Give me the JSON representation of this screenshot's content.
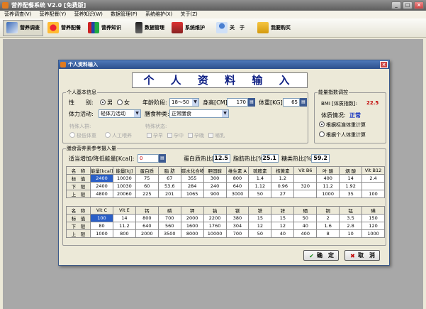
{
  "app": {
    "title": "营养配餐系统 V2.0 [免费版]"
  },
  "menubar": [
    "营养调查(V)",
    "营养配餐(Y)",
    "营养知识(W)",
    "数据管理(P)",
    "系统维护(X)",
    "关于(Z)"
  ],
  "toolbar": [
    "营养调查",
    "营养配餐",
    "营养知识",
    "数据管理",
    "系统维护",
    "关　于",
    "我要购买"
  ],
  "colors": {
    "title_blue": "#0e1f83",
    "bmi_red": "#c00000",
    "status_blue": "#1030c0"
  },
  "dialog": {
    "title": "个人资料输入",
    "heading": "个 人 资 料 输 入",
    "basic": {
      "legend": "个人基本信息",
      "gender_label": "性　　别:",
      "male": "男",
      "female": "女",
      "age_label": "年龄阶段:",
      "age_value": "18～50",
      "height_label": "身高[CM]:",
      "height_value": "170",
      "weight_label": "体重[KG]:",
      "weight_value": "65",
      "activity_label": "体力活动:",
      "activity_value": "轻体力活动",
      "diet_label": "膳食种类:",
      "diet_value": "正常膳食",
      "special_groups": [
        "特殊人群:",
        "极低体重",
        "人工喂养"
      ],
      "special_state": [
        "特殊状态:",
        "孕早",
        "孕中",
        "孕晚",
        "哺乳"
      ]
    },
    "bmi": {
      "legend": "能量指数调控",
      "bmi_label": "BMI [体质指数]:",
      "bmi_value": "22.5",
      "status_label": "体质情况:",
      "status_value": "正常",
      "opt1": "根据标准体重计算",
      "opt2": "根据个人体重计算"
    },
    "ref": {
      "legend": "膳食营养素参考摄入量",
      "adjust_label": "适当增加/降低能量[Kcal]:",
      "adjust_value": "0",
      "protein_label": "蛋白质热比[%]",
      "protein_value": "12.5",
      "fat_label": "脂肪热比[%]",
      "fat_value": "25.1",
      "carb_label": "糖类热比[%]",
      "carb_value": "59.2"
    },
    "table1": {
      "headers": [
        "名　称",
        "能量[kcal]",
        "能量[kJ]",
        "蛋白质",
        "脂 肪",
        "碳水化合物",
        "胆固醇",
        "维生素 A",
        "硫胺素",
        "核黄素",
        "Vit B6",
        "叶 酸",
        "烟 酸",
        "Vit B12"
      ],
      "rows": [
        [
          "标　值",
          "2400",
          "10030",
          "75",
          "67",
          "355",
          "300",
          "800",
          "1.4",
          "1.2",
          "400",
          "14",
          "2.4"
        ],
        [
          "下　限",
          "2400",
          "10030",
          "60",
          "53.6",
          "284",
          "240",
          "640",
          "1.12",
          "0.96",
          "320",
          "11.2",
          "1.92"
        ],
        [
          "上　限",
          "4800",
          "20060",
          "225",
          "201",
          "1065",
          "900",
          "3000",
          "50",
          "27",
          "1000",
          "35",
          "100"
        ]
      ]
    },
    "table2": {
      "headers": [
        "名　称",
        "Vit C",
        "Vit E",
        "钙",
        "磷",
        "钾",
        "钠",
        "镁",
        "铁",
        "锌",
        "硒",
        "铜",
        "锰",
        "碘"
      ],
      "rows": [
        [
          "标　值",
          "100",
          "14",
          "800",
          "700",
          "2000",
          "2200",
          "380",
          "15",
          "15",
          "50",
          "2",
          "3.5",
          "150"
        ],
        [
          "下　限",
          "80",
          "11.2",
          "640",
          "560",
          "1600",
          "1760",
          "304",
          "12",
          "12",
          "40",
          "1.6",
          "2.8",
          "120"
        ],
        [
          "上　限",
          "1000",
          "800",
          "2000",
          "3500",
          "8000",
          "10000",
          "700",
          "50",
          "40",
          "400",
          "8",
          "10",
          "1000"
        ]
      ]
    },
    "ok": "确　定",
    "cancel": "取　消"
  }
}
